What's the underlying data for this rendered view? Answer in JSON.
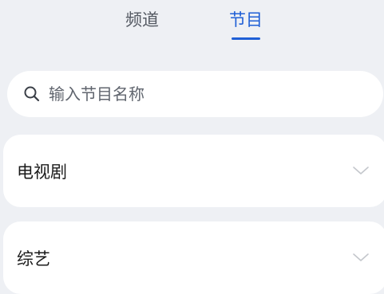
{
  "tabs": [
    {
      "label": "频道",
      "active": false
    },
    {
      "label": "节目",
      "active": true
    }
  ],
  "search": {
    "placeholder": "输入节目名称",
    "value": "",
    "icon": "search-icon"
  },
  "categories": [
    {
      "label": "电视剧",
      "icon": "chevron-down-icon"
    },
    {
      "label": "综艺",
      "icon": "chevron-down-icon"
    }
  ],
  "colors": {
    "accent": "#1f5fd6",
    "background": "#eef0f4",
    "card": "#ffffff",
    "tab_inactive": "#555a63",
    "chevron": "#c4c7cc"
  }
}
